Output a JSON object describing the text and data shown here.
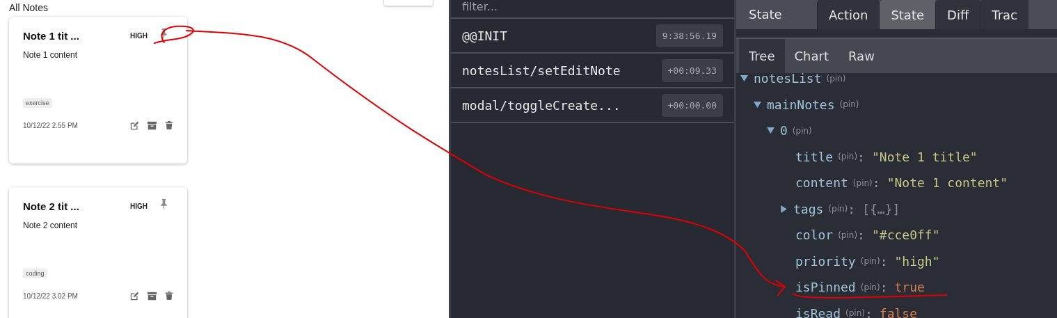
{
  "notes_panel": {
    "heading": "All Notes",
    "notes": [
      {
        "title": "Note 1 tit ...",
        "priority": "HIGH",
        "content": "Note 1 content",
        "tags": [
          "exercise"
        ],
        "date": "10/12/22 2.55 PM"
      },
      {
        "title": "Note 2 tit ...",
        "priority": "HIGH",
        "content": "Note 2 content",
        "tags": [
          "coding"
        ],
        "date": "10/12/22 3.02 PM"
      }
    ]
  },
  "devtools": {
    "action_list": {
      "filter": {
        "placeholder": "filter..."
      },
      "actions": [
        {
          "name": "@@INIT",
          "time": "9:38:56.19"
        },
        {
          "name": "notesList/setEditNote",
          "time": "+00:09.33"
        },
        {
          "name": "modal/toggleCreate...",
          "time": "+00:00.00"
        }
      ]
    },
    "inspector": {
      "title": "State",
      "tabs": [
        {
          "label": "Action",
          "selected": false
        },
        {
          "label": "State",
          "selected": true
        },
        {
          "label": "Diff",
          "selected": false
        },
        {
          "label": "Trac",
          "selected": false
        }
      ],
      "view_tabs": [
        {
          "label": "Tree",
          "selected": true
        },
        {
          "label": "Chart",
          "selected": false
        },
        {
          "label": "Raw",
          "selected": false
        }
      ],
      "tree": [
        {
          "key": "notesList",
          "pin": "(pin)",
          "expanded": true,
          "children": [
            {
              "key": "mainNotes",
              "pin": "(pin)",
              "expanded": true,
              "children": [
                {
                  "key": "0",
                  "pin": "(pin)",
                  "expanded": true,
                  "children": [
                    {
                      "key": "title",
                      "pin": "(pin)",
                      "sep": ":",
                      "kind": "string",
                      "value": "\"Note 1 title\""
                    },
                    {
                      "key": "content",
                      "pin": "(pin)",
                      "sep": ":",
                      "kind": "string",
                      "value": "\"Note 1 content\""
                    },
                    {
                      "key": "tags",
                      "pin": "(pin)",
                      "sep": ":",
                      "kind": "array",
                      "expanded": false,
                      "value": "[{…}]"
                    },
                    {
                      "key": "color",
                      "pin": "(pin)",
                      "sep": ":",
                      "kind": "string",
                      "value": "\"#cce0ff\""
                    },
                    {
                      "key": "priority",
                      "pin": "(pin)",
                      "sep": ":",
                      "kind": "string",
                      "value": "\"high\""
                    },
                    {
                      "key": "isPinned",
                      "pin": "(pin)",
                      "sep": ":",
                      "kind": "boolean",
                      "value": "true"
                    },
                    {
                      "key": "isRead",
                      "pin": "(pin)",
                      "sep": ":",
                      "kind": "boolean",
                      "value": "false"
                    }
                  ]
                }
              ]
            }
          ]
        }
      ]
    }
  },
  "annotation": {
    "kind": "freehand-arrow"
  }
}
